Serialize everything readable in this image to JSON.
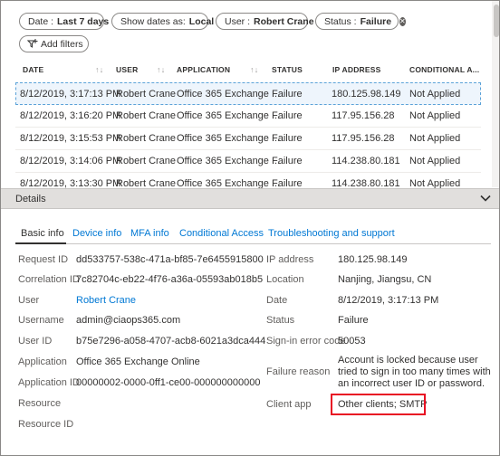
{
  "filters": [
    {
      "key": "Date :",
      "value": "Last 7 days"
    },
    {
      "key": "Show dates as:",
      "value": "Local"
    },
    {
      "key": "User :",
      "value": "Robert Crane"
    },
    {
      "key": "Status :",
      "value": "Failure"
    }
  ],
  "add_filters_label": "Add filters",
  "table": {
    "columns": [
      "DATE",
      "USER",
      "APPLICATION",
      "STATUS",
      "IP ADDRESS",
      "CONDITIONAL A..."
    ],
    "rows": [
      [
        "8/12/2019, 3:17:13 PM",
        "Robert Crane",
        "Office 365 Exchange ...",
        "Failure",
        "180.125.98.149",
        "Not Applied"
      ],
      [
        "8/12/2019, 3:16:20 PM",
        "Robert Crane",
        "Office 365 Exchange ...",
        "Failure",
        "117.95.156.28",
        "Not Applied"
      ],
      [
        "8/12/2019, 3:15:53 PM",
        "Robert Crane",
        "Office 365 Exchange ...",
        "Failure",
        "117.95.156.28",
        "Not Applied"
      ],
      [
        "8/12/2019, 3:14:06 PM",
        "Robert Crane",
        "Office 365 Exchange ...",
        "Failure",
        "114.238.80.181",
        "Not Applied"
      ],
      [
        "8/12/2019, 3:13:30 PM",
        "Robert Crane",
        "Office 365 Exchange ...",
        "Failure",
        "114.238.80.181",
        "Not Applied"
      ]
    ]
  },
  "details_title": "Details",
  "tabs": [
    "Basic info",
    "Device info",
    "MFA info",
    "Conditional Access",
    "Troubleshooting and support"
  ],
  "left_fields": [
    {
      "label": "Request ID",
      "value": "dd533757-538c-471a-bf85-7e6455915800"
    },
    {
      "label": "Correlation ID",
      "value": "7c82704c-eb22-4f76-a36a-05593ab018b5"
    },
    {
      "label": "User",
      "value": "Robert Crane"
    },
    {
      "label": "Username",
      "value": "admin@ciaops365.com"
    },
    {
      "label": "User ID",
      "value": "b75e7296-a058-4707-acb8-6021a3dca444"
    },
    {
      "label": "Application",
      "value": "Office 365 Exchange Online"
    },
    {
      "label": "Application ID",
      "value": "00000002-0000-0ff1-ce00-000000000000"
    },
    {
      "label": "Resource",
      "value": ""
    },
    {
      "label": "Resource ID",
      "value": ""
    }
  ],
  "right_fields": [
    {
      "label": "IP address",
      "value": "180.125.98.149"
    },
    {
      "label": "Location",
      "value": "Nanjing, Jiangsu, CN"
    },
    {
      "label": "Date",
      "value": "8/12/2019, 3:17:13 PM"
    },
    {
      "label": "Status",
      "value": "Failure"
    },
    {
      "label": "Sign-in error code",
      "value": "50053"
    },
    {
      "label": "Failure reason",
      "value": "Account is locked because user tried to sign in too many times with an incorrect user ID or password."
    },
    {
      "label": "Client app",
      "value": "Other clients; SMTP"
    }
  ],
  "colors": {
    "link": "#0078d4",
    "highlight_box": "#e81123",
    "selected_row": "#eef5fc"
  }
}
